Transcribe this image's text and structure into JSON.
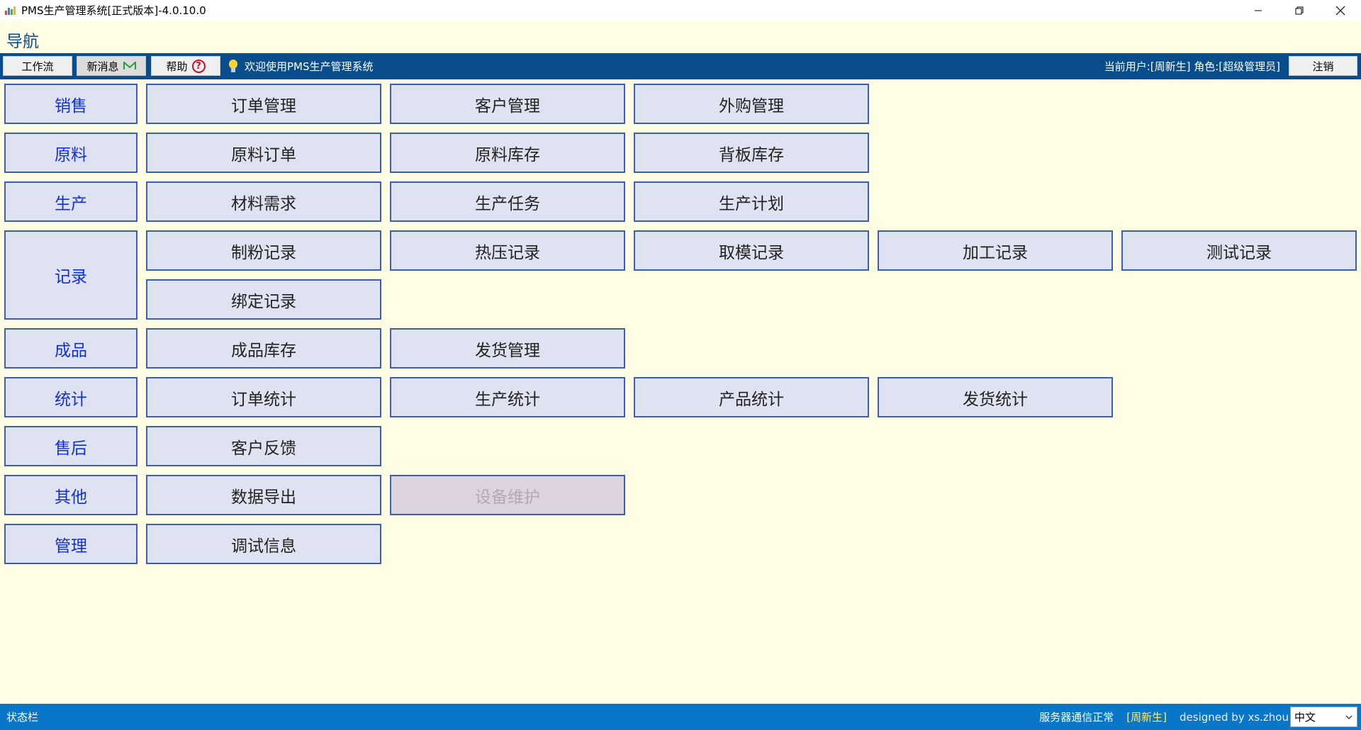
{
  "window": {
    "title": "PMS生产管理系统[正式版本]-4.0.10.0"
  },
  "nav": {
    "title": "导航"
  },
  "toolbar": {
    "workflow_label": "工作流",
    "new_message_label": "新消息",
    "help_label": "帮助",
    "help_glyph": "?",
    "welcome_text": "欢迎使用PMS生产管理系统",
    "user_info": "当前用户:[周新生] 角色:[超级管理员]",
    "logout_label": "注销"
  },
  "rows": [
    {
      "category": "销售",
      "items": [
        "订单管理",
        "客户管理",
        "外购管理"
      ]
    },
    {
      "category": "原料",
      "items": [
        "原料订单",
        "原料库存",
        "背板库存"
      ]
    },
    {
      "category": "生产",
      "items": [
        "材料需求",
        "生产任务",
        "生产计划"
      ]
    },
    {
      "category": "记录",
      "items": [
        "制粉记录",
        "热压记录",
        "取模记录",
        "加工记录",
        "测试记录",
        "绑定记录"
      ]
    },
    {
      "category": "成品",
      "items": [
        "成品库存",
        "发货管理"
      ]
    },
    {
      "category": "统计",
      "items": [
        "订单统计",
        "生产统计",
        "产品统计",
        "发货统计"
      ]
    },
    {
      "category": "售后",
      "items": [
        "客户反馈"
      ]
    },
    {
      "category": "其他",
      "items": [
        "数据导出",
        "设备维护"
      ],
      "disabled": [
        "设备维护"
      ]
    },
    {
      "category": "管理",
      "items": [
        "调试信息"
      ]
    }
  ],
  "statusbar": {
    "label": "状态栏",
    "server_status": "服务器通信正常",
    "user": "[周新生]",
    "credit": "designed by xs.zhou",
    "language": "中文"
  },
  "colors": {
    "background": "#fffde3",
    "toolbar": "#0a4d8c",
    "statusbar": "#0a76c8",
    "button_fill": "#dfe2f0",
    "button_border": "#3a5fb0",
    "category_text": "#1030d8"
  }
}
